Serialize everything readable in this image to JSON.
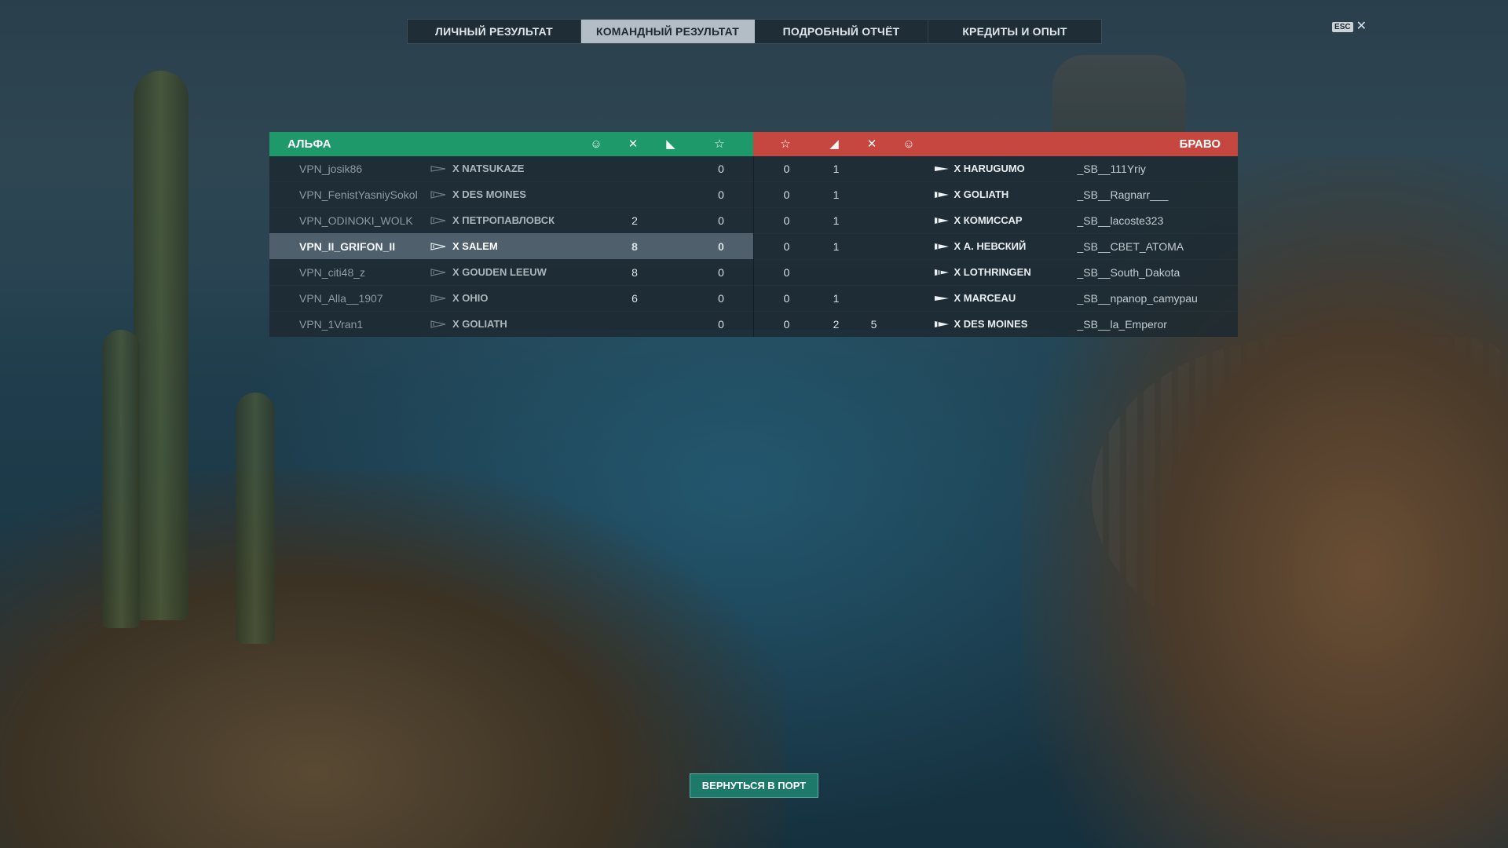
{
  "tabs": [
    {
      "label": "ЛИЧНЫЙ РЕЗУЛЬТАТ",
      "active": false
    },
    {
      "label": "КОМАНДНЫЙ РЕЗУЛЬТАТ",
      "active": true
    },
    {
      "label": "ПОДРОБНЫЙ ОТЧЁТ",
      "active": false
    },
    {
      "label": "КРЕДИТЫ И ОПЫТ",
      "active": false
    }
  ],
  "esc": {
    "key": "ESC",
    "close": "✕"
  },
  "colors": {
    "alpha": "#1e9a6a",
    "bravo": "#c5473f",
    "highlight": "#a0b4c3"
  },
  "alpha": {
    "title": "АЛЬФА",
    "columns": [
      "capture-icon",
      "plane-kills-icon",
      "ship-kills-icon",
      "star-icon"
    ],
    "rows": [
      {
        "player": "VPN_josik86",
        "ship": "X NATSUKAZE",
        "class": "destroyer",
        "c1": "",
        "c2": "",
        "c3": "",
        "score": "0"
      },
      {
        "player": "VPN_FenistYasniySokol",
        "ship": "X DES MOINES",
        "class": "cruiser",
        "c1": "",
        "c2": "",
        "c3": "",
        "score": "0"
      },
      {
        "player": "VPN_ODINOKI_WOLK",
        "ship": "X ПЕТРОПАВЛОВСК",
        "class": "cruiser",
        "c1": "",
        "c2": "2",
        "c3": "",
        "score": "0"
      },
      {
        "player": "VPN_II_GRIFON_II",
        "ship": "X SALEM",
        "class": "cruiser",
        "c1": "",
        "c2": "8",
        "c3": "",
        "score": "0",
        "highlight": true
      },
      {
        "player": "VPN_citi48_z",
        "ship": "X GOUDEN LEEUW",
        "class": "cruiser",
        "c1": "",
        "c2": "8",
        "c3": "",
        "score": "0"
      },
      {
        "player": "VPN_Alla__1907",
        "ship": "X OHIO",
        "class": "battleship",
        "c1": "",
        "c2": "6",
        "c3": "",
        "score": "0"
      },
      {
        "player": "VPN_1Vran1",
        "ship": "X GOLIATH",
        "class": "cruiser",
        "c1": "",
        "c2": "",
        "c3": "",
        "score": "0"
      }
    ]
  },
  "bravo": {
    "title": "БРАВО",
    "columns": [
      "star-icon",
      "ship-kills-icon",
      "plane-kills-icon",
      "capture-icon"
    ],
    "rows": [
      {
        "score": "0",
        "c1": "1",
        "c2": "",
        "c3": "",
        "ship": "X HARUGUMO",
        "class": "destroyer",
        "player": "_SB__111Yriy"
      },
      {
        "score": "0",
        "c1": "1",
        "c2": "",
        "c3": "",
        "ship": "X GOLIATH",
        "class": "cruiser",
        "player": "_SB__Ragnarr___"
      },
      {
        "score": "0",
        "c1": "1",
        "c2": "",
        "c3": "",
        "ship": "X КОМИССАР",
        "class": "cruiser",
        "player": "_SB__lacoste323"
      },
      {
        "score": "0",
        "c1": "1",
        "c2": "",
        "c3": "",
        "ship": "X А. НЕВСКИЙ",
        "class": "cruiser",
        "player": "_SB__CBET_ATOMA"
      },
      {
        "score": "0",
        "c1": "",
        "c2": "",
        "c3": "",
        "ship": "X LOTHRINGEN",
        "class": "battleship",
        "player": "_SB__South_Dakota"
      },
      {
        "score": "0",
        "c1": "1",
        "c2": "",
        "c3": "",
        "ship": "X MARCEAU",
        "class": "destroyer",
        "player": "_SB__npanop_camypau"
      },
      {
        "score": "0",
        "c1": "2",
        "c2": "5",
        "c3": "",
        "ship": "X DES MOINES",
        "class": "cruiser",
        "player": "_SB__la_Emperor"
      }
    ]
  },
  "return_button": "ВЕРНУТЬСЯ В ПОРТ"
}
